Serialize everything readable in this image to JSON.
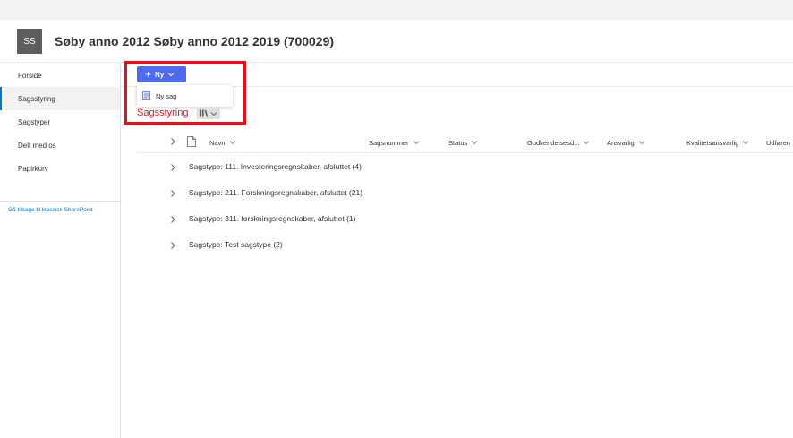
{
  "site": {
    "logo_initials": "SS",
    "title": "Søby anno 2012 Søby anno 2012 2019 (700029)"
  },
  "nav": {
    "items": [
      {
        "label": "Forside"
      },
      {
        "label": "Sagsstyring"
      },
      {
        "label": "Sagstyper"
      },
      {
        "label": "Delt med os"
      },
      {
        "label": "Papirkurv"
      }
    ],
    "classic_link": "Gå tilbage til klassisk SharePoint"
  },
  "toolbar": {
    "new_label": "Ny",
    "new_menu": [
      {
        "label": "Ny sag"
      }
    ]
  },
  "list": {
    "title": "Sagsstyring",
    "columns": [
      "Navn",
      "Sagsnummer",
      "Status",
      "Godkendelsesd...",
      "Ansvarlig",
      "Kvalitetsansvarlig",
      "Udføren"
    ],
    "groups": [
      {
        "label": "Sagstype: 111. Investeringsregnskaber, afsluttet (4)"
      },
      {
        "label": "Sagstype: 211. Forskningsregnskaber, afsluttet (21)"
      },
      {
        "label": "Sagstype: 311. forskningsregnskaber, afsluttet (1)"
      },
      {
        "label": "Sagstype: Test sagstype (2)"
      }
    ]
  },
  "colors": {
    "accent": "#4f6bed",
    "highlight": "#e3111c",
    "title_red": "#e81123",
    "logo_bg": "#605e5c"
  }
}
